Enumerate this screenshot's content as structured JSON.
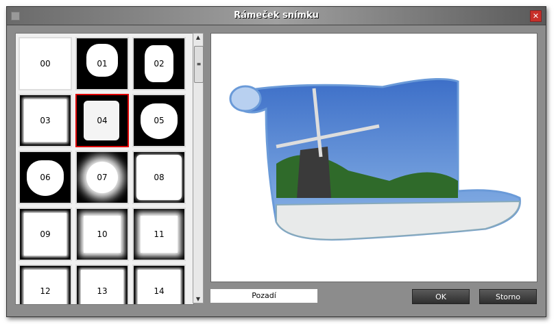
{
  "window": {
    "title": "Rámeček snímku"
  },
  "frames": [
    {
      "label": "00",
      "style": "plain"
    },
    {
      "label": "01",
      "style": "leaf"
    },
    {
      "label": "02",
      "style": "snowflake"
    },
    {
      "label": "03",
      "style": "rough"
    },
    {
      "label": "04",
      "style": "scroll",
      "selected": true
    },
    {
      "label": "05",
      "style": "heart"
    },
    {
      "label": "06",
      "style": "heart"
    },
    {
      "label": "07",
      "style": "glow"
    },
    {
      "label": "08",
      "style": "soft"
    },
    {
      "label": "09",
      "style": "rough"
    },
    {
      "label": "10",
      "style": "halftone"
    },
    {
      "label": "11",
      "style": "halftone"
    },
    {
      "label": "12",
      "style": "rough"
    },
    {
      "label": "13",
      "style": "rough"
    },
    {
      "label": "14",
      "style": "rough"
    }
  ],
  "background_label": "Pozadí",
  "buttons": {
    "ok": "OK",
    "cancel": "Storno"
  },
  "colors": {
    "selection": "#e00000",
    "sky": "#4a7fd0"
  }
}
